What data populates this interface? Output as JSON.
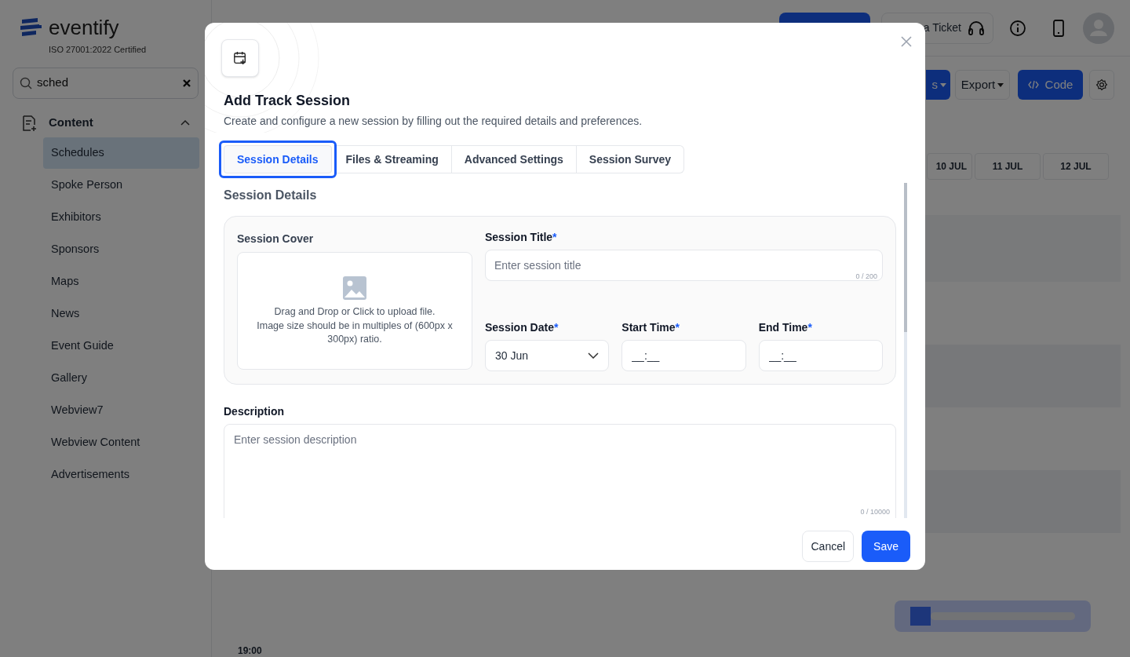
{
  "sidebar": {
    "logo_text": "eventify",
    "certification": "ISO 27001:2022 Certified",
    "search": {
      "value": "sched"
    },
    "section": {
      "label": "Content",
      "expanded": true,
      "items": [
        {
          "label": "Schedules",
          "selected": true
        },
        {
          "label": "Spoke Person",
          "selected": false
        },
        {
          "label": "Exhibitors",
          "selected": false
        },
        {
          "label": "Sponsors",
          "selected": false
        },
        {
          "label": "Maps",
          "selected": false
        },
        {
          "label": "News",
          "selected": false
        },
        {
          "label": "Event Guide",
          "selected": false
        },
        {
          "label": "Gallery",
          "selected": false
        },
        {
          "label": "Webview7",
          "selected": false
        },
        {
          "label": "Webview Content",
          "selected": false
        },
        {
          "label": "Advertisements",
          "selected": false
        }
      ]
    }
  },
  "topbar": {
    "ticket_button": "a Ticket"
  },
  "toolbar": {
    "partial_button": "s",
    "export_button": "Export",
    "code_button": "Code"
  },
  "calendar": {
    "days": [
      "10 JUL",
      "11 JUL",
      "12 JUL"
    ],
    "time": "19:00"
  },
  "modal": {
    "title": "Add Track Session",
    "subtitle": "Create and configure a new session by filling out the required details and preferences.",
    "tabs": [
      {
        "label": "Session Details",
        "selected": true
      },
      {
        "label": "Files & Streaming",
        "selected": false
      },
      {
        "label": "Advanced Settings",
        "selected": false
      },
      {
        "label": "Session Survey",
        "selected": false
      }
    ],
    "section_title": "Session Details",
    "cover": {
      "label": "Session Cover",
      "hint": "Drag and Drop or Click to upload file.",
      "size_note": "Image size should be in multiples of (600px x 300px) ratio."
    },
    "session_title": {
      "label": "Session Title",
      "required_mark": "*",
      "placeholder": "Enter session title",
      "counter": "0 / 200"
    },
    "session_date": {
      "label": "Session Date",
      "required_mark": "*",
      "value": "30 Jun"
    },
    "start_time": {
      "label": "Start Time",
      "required_mark": "*",
      "value": "__:__"
    },
    "end_time": {
      "label": "End Time",
      "required_mark": "*",
      "value": "__:__"
    },
    "description": {
      "label": "Description",
      "placeholder": "Enter session description",
      "counter": "0 / 10000"
    },
    "buttons": {
      "cancel": "Cancel",
      "save": "Save"
    }
  }
}
